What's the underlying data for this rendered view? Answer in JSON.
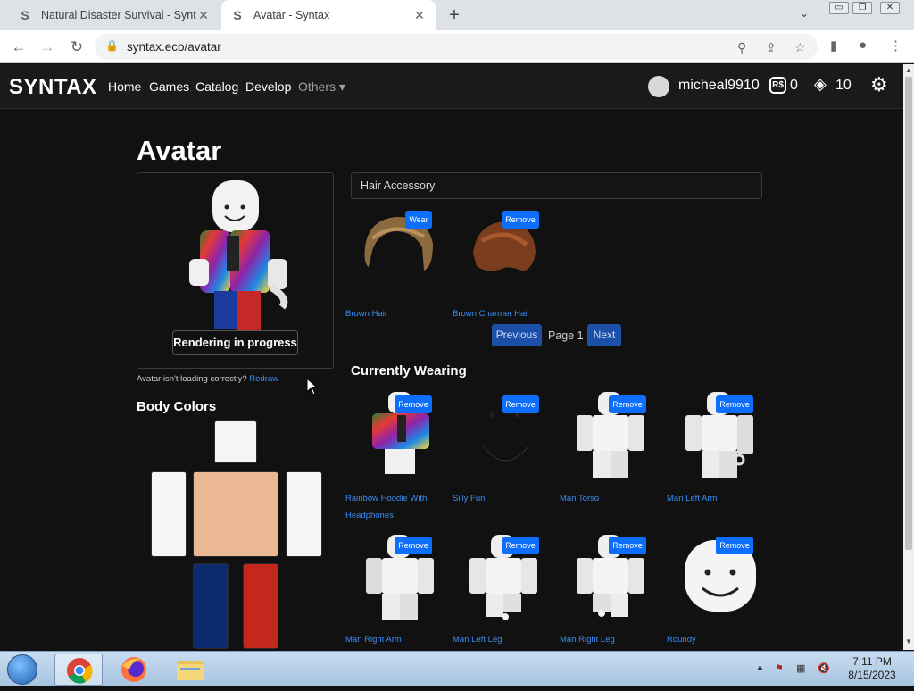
{
  "browser": {
    "tabs": [
      {
        "title": "Natural Disaster Survival - Syntax",
        "active": false
      },
      {
        "title": "Avatar - Syntax",
        "active": true
      }
    ],
    "url": "syntax.eco/avatar",
    "icons": {
      "favicon": "S",
      "close": "✕",
      "newtab": "+",
      "tablist": "⌄",
      "back": "←",
      "forward": "→",
      "reload": "↻",
      "lock": "🔒",
      "zoom": "⚲",
      "share": "⇪",
      "star": "☆",
      "sidepanel": "▮",
      "profile": "●",
      "menu": "⋮",
      "minimize": "▭",
      "restore": "❐",
      "close_window": "✕"
    }
  },
  "site": {
    "brand": "SYNTAX",
    "nav": [
      "Home",
      "Games",
      "Catalog",
      "Develop",
      "Others ▾"
    ],
    "username": "micheal9910",
    "robux_symbol": "R$",
    "robux": "0",
    "tix_symbol": "◈",
    "tix": "10",
    "gear_symbol": "⚙"
  },
  "page": {
    "title": "Avatar",
    "render_status": "Rendering in progress",
    "redraw_prompt": "Avatar isn't loading correctly?",
    "redraw_link": "Redraw",
    "body_colors_title": "Body Colors",
    "body_colors": {
      "head": "#f5f5f5",
      "torso": "#eab892",
      "left_arm": "#f5f5f5",
      "right_arm": "#f5f5f5",
      "left_leg": "#0d2a6e",
      "right_leg": "#c4281c"
    },
    "category": "Hair Accessory",
    "inventory": [
      {
        "name": "Brown Hair",
        "button": "Wear"
      },
      {
        "name": "Brown Charmer Hair",
        "button": "Remove"
      }
    ],
    "pagination": {
      "previous": "Previous",
      "label": "Page 1",
      "next": "Next"
    },
    "currently_wearing_title": "Currently Wearing",
    "wearing": [
      {
        "name": "Rainbow Hoodie With Headphones",
        "button": "Remove"
      },
      {
        "name": "Silly Fun",
        "button": "Remove"
      },
      {
        "name": "Man Torso",
        "button": "Remove"
      },
      {
        "name": "Man Left Arm",
        "button": "Remove"
      },
      {
        "name": "Man Right Arm",
        "button": "Remove"
      },
      {
        "name": "Man Left Leg",
        "button": "Remove"
      },
      {
        "name": "Man Right Leg",
        "button": "Remove"
      },
      {
        "name": "Roundy",
        "button": "Remove"
      }
    ]
  },
  "taskbar": {
    "time": "7:11 PM",
    "date": "8/15/2023",
    "apps": [
      "chrome-icon",
      "firefox-icon",
      "file-explorer-icon"
    ],
    "tray_symbols": {
      "arrow": "▲",
      "flag": "⚑",
      "network": "▦",
      "volume": "🔇"
    }
  },
  "colors": {
    "accent": "#0d6efd",
    "link": "#3a8df0",
    "background": "#111111",
    "navbar": "#1a1a1a"
  }
}
